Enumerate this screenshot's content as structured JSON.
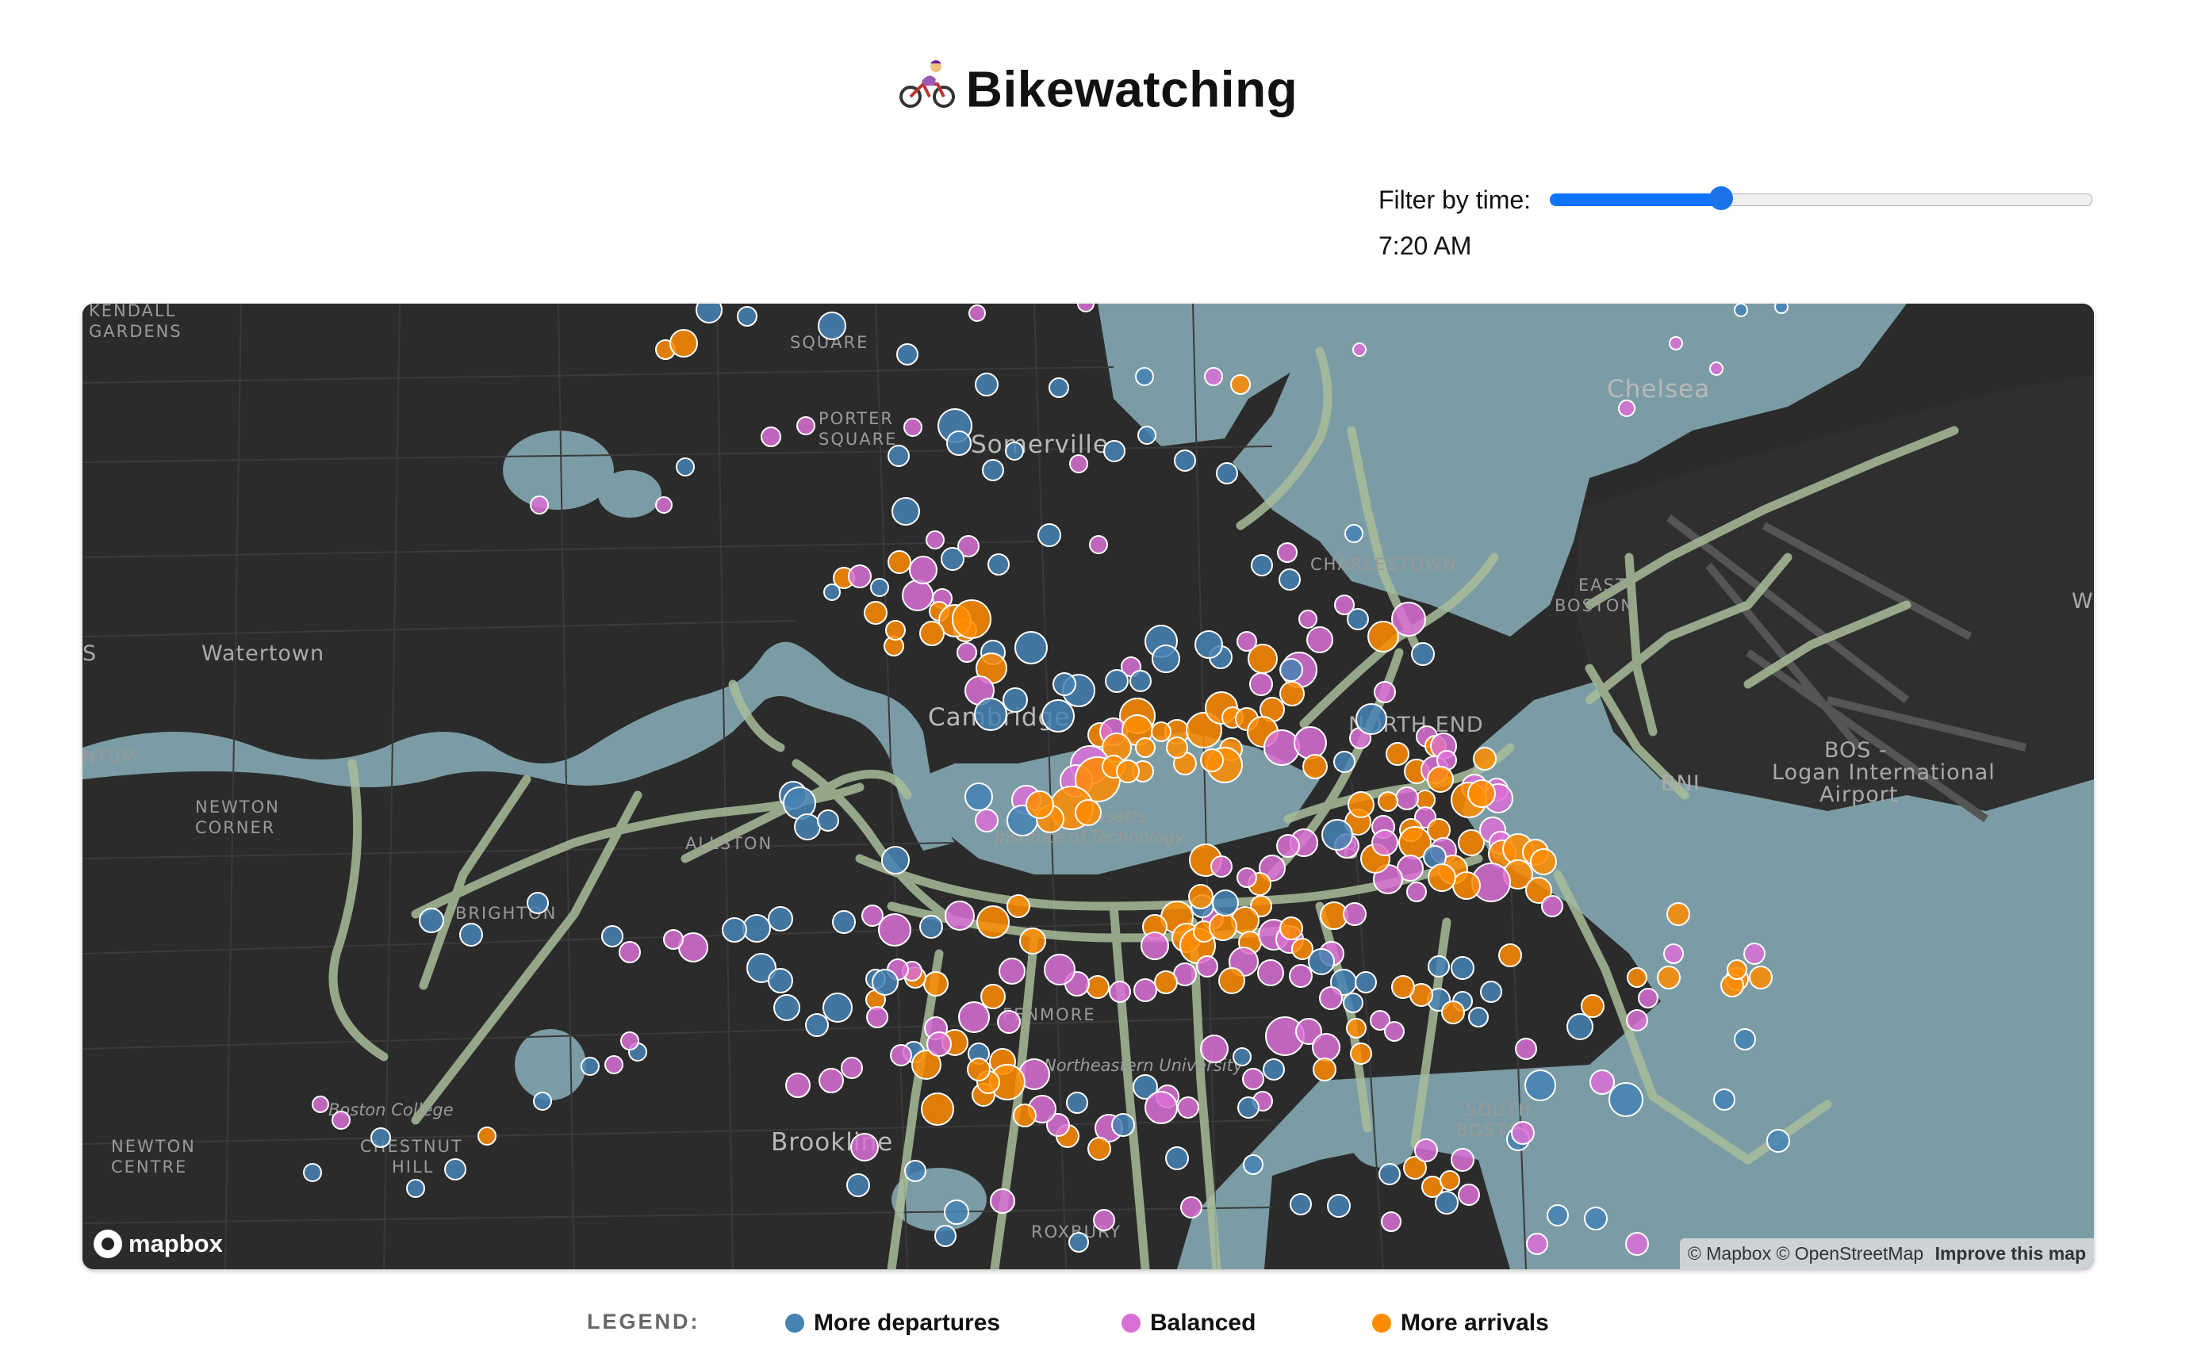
{
  "header": {
    "title": "Bikewatching",
    "icon": "cyclist-icon"
  },
  "filter": {
    "label": "Filter by time:",
    "time_value": "7:20 AM",
    "slider_fraction": 0.317
  },
  "map": {
    "places": [
      {
        "id": "kendall",
        "text": "KENDALL"
      },
      {
        "id": "gardens",
        "text": "GARDENS"
      },
      {
        "id": "square",
        "text": "SQUARE"
      },
      {
        "id": "porter1",
        "text": "PORTER"
      },
      {
        "id": "porter2",
        "text": "SQUARE"
      },
      {
        "id": "somerville",
        "text": "Somerville"
      },
      {
        "id": "chelsea",
        "text": "Chelsea"
      },
      {
        "id": "charlestown",
        "text": "CHARLESTOWN"
      },
      {
        "id": "eastboston1",
        "text": "EAST"
      },
      {
        "id": "eastboston2",
        "text": "BOSTON"
      },
      {
        "id": "watertown",
        "text": "Watertown"
      },
      {
        "id": "cambridge",
        "text": "Cambridge"
      },
      {
        "id": "northend",
        "text": "NORTH END"
      },
      {
        "id": "bos1",
        "text": "BOS -"
      },
      {
        "id": "bos2",
        "text": "Logan International"
      },
      {
        "id": "bos3",
        "text": "Airport"
      },
      {
        "id": "bni",
        "text": "BNI"
      },
      {
        "id": "newtum",
        "text": "NTUM"
      },
      {
        "id": "newton1",
        "text": "NEWTON"
      },
      {
        "id": "newton2",
        "text": "CORNER"
      },
      {
        "id": "mit1",
        "text": "Massachusetts"
      },
      {
        "id": "mit2",
        "text": "Institute of Technology"
      },
      {
        "id": "allston",
        "text": "ALLSTON"
      },
      {
        "id": "brighton",
        "text": "BRIGHTON"
      },
      {
        "id": "boston",
        "text": "B"
      },
      {
        "id": "fenmore",
        "text": "FENMORE"
      },
      {
        "id": "northeastern",
        "text": "Northeastern University"
      },
      {
        "id": "bc",
        "text": "Boston College"
      },
      {
        "id": "nc1",
        "text": "NEWTON"
      },
      {
        "id": "nc2",
        "text": "CENTRE"
      },
      {
        "id": "ch1",
        "text": "CHESTNUT"
      },
      {
        "id": "ch2",
        "text": "HILL"
      },
      {
        "id": "brookline",
        "text": "Brookline"
      },
      {
        "id": "southboston1",
        "text": "SOUTH"
      },
      {
        "id": "southboston2",
        "text": "BOSTON"
      },
      {
        "id": "roxbury",
        "text": "ROXBURY"
      },
      {
        "id": "w",
        "text": "W"
      },
      {
        "id": "s",
        "text": "S"
      }
    ],
    "logo": "mapbox",
    "attribution": "© Mapbox © OpenStreetMap",
    "improve_link": "Improve this map"
  },
  "legend": {
    "title": "LEGEND:",
    "items": [
      {
        "label": "More departures",
        "color": "#4682b4"
      },
      {
        "label": "Balanced",
        "color": "#da70d6"
      },
      {
        "label": "More arrivals",
        "color": "#ff8c00"
      }
    ]
  }
}
